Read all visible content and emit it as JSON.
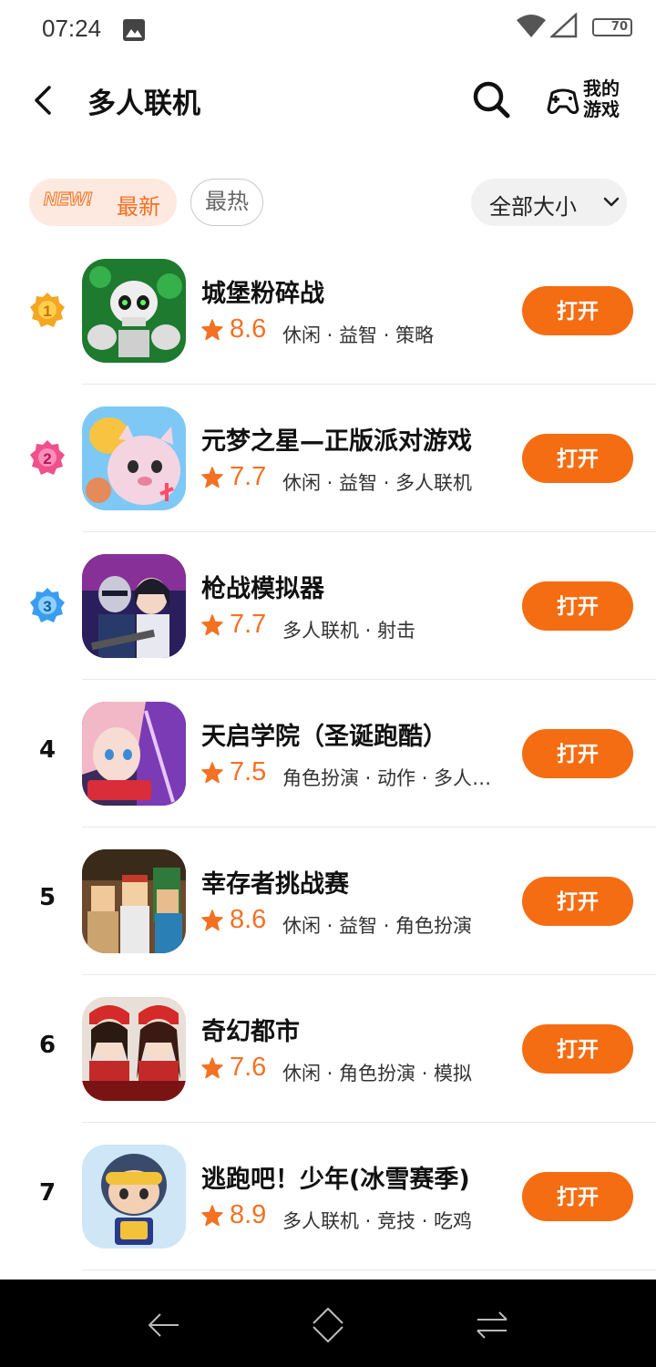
{
  "status": {
    "time": "07:24",
    "battery": "70"
  },
  "header": {
    "title": "多人联机",
    "my_games_label": "我的游戏"
  },
  "filters": {
    "new_badge": "NEW!",
    "newest": "最新",
    "hottest": "最热",
    "size": "全部大小"
  },
  "games": [
    {
      "rank": "1",
      "name": "城堡粉碎战",
      "rating": "8.6",
      "tags": "休闲 · 益智 · 策略",
      "button": "打开"
    },
    {
      "rank": "2",
      "name": "元梦之星—正版派对游戏",
      "rating": "7.7",
      "tags": "休闲 · 益智 · 多人联机",
      "button": "打开"
    },
    {
      "rank": "3",
      "name": "枪战模拟器",
      "rating": "7.7",
      "tags": "多人联机 · 射击",
      "button": "打开"
    },
    {
      "rank": "4",
      "name": "天启学院（圣诞跑酷）",
      "rating": "7.5",
      "tags": "角色扮演 · 动作 · 多人联机",
      "button": "打开"
    },
    {
      "rank": "5",
      "name": "幸存者挑战赛",
      "rating": "8.6",
      "tags": "休闲 · 益智 · 角色扮演",
      "button": "打开"
    },
    {
      "rank": "6",
      "name": "奇幻都市",
      "rating": "7.6",
      "tags": "休闲 · 角色扮演 · 模拟",
      "button": "打开"
    },
    {
      "rank": "7",
      "name": "逃跑吧！少年(冰雪赛季)",
      "rating": "8.9",
      "tags": "多人联机 · 竞技 · 吃鸡",
      "button": "打开"
    }
  ],
  "colors": {
    "accent": "#f46d13",
    "rating": "#f37123",
    "gold": "#f5a623",
    "pink": "#f0508c",
    "blue": "#3a9ef0"
  }
}
